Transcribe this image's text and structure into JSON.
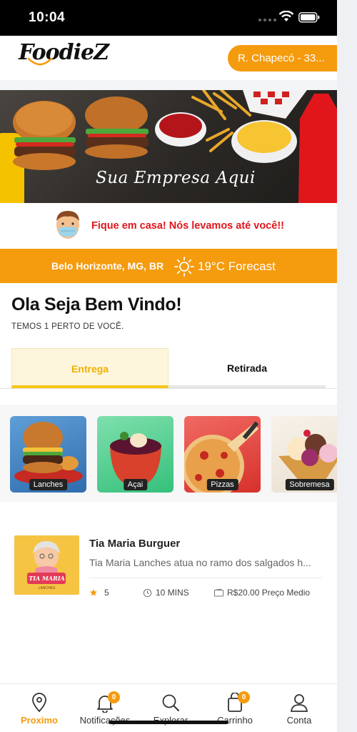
{
  "status_bar": {
    "time": "10:04"
  },
  "header": {
    "logo_text": "FoodieZ",
    "address": "R. Chapecó - 33..."
  },
  "banner": {
    "text": "Sua Empresa Aqui"
  },
  "notice": {
    "text": "Fique em casa! Nós levamos até você!!"
  },
  "weather": {
    "location": "Belo Horizonte, MG, BR",
    "forecast": "19°C Forecast"
  },
  "welcome": {
    "title": "Ola Seja Bem Vindo!",
    "subtitle": "TEMOS 1 PERTO DE VOCÊ."
  },
  "tabs": [
    {
      "label": "Entrega",
      "active": true
    },
    {
      "label": "Retirada",
      "active": false
    }
  ],
  "categories": [
    {
      "label": "Lanches",
      "icon": "burger-image"
    },
    {
      "label": "Açai",
      "icon": "acai-bowl-image"
    },
    {
      "label": "Pizzas",
      "icon": "pizza-image"
    },
    {
      "label": "Sobremesa",
      "icon": "dessert-image"
    }
  ],
  "restaurant": {
    "name": "Tia Maria Burguer",
    "description": "Tia Maria Lanches atua no ramo dos salgados h...",
    "rating": "5",
    "time": "10 MINS",
    "price": "R$20.00 Preço Medio",
    "thumb_text": "TIA MARIA",
    "thumb_sub": "LANCHES"
  },
  "bottom_nav": [
    {
      "label": "Proximo",
      "icon": "location-pin-icon",
      "active": true
    },
    {
      "label": "Notificações",
      "icon": "bell-icon",
      "badge": "0"
    },
    {
      "label": "Explorar",
      "icon": "search-icon"
    },
    {
      "label": "Carrinho",
      "icon": "bag-icon",
      "badge": "0"
    },
    {
      "label": "Conta",
      "icon": "user-icon"
    }
  ],
  "colors": {
    "accent": "#f59b0e",
    "alert": "#e0161b",
    "tab_active": "#f0b000"
  }
}
